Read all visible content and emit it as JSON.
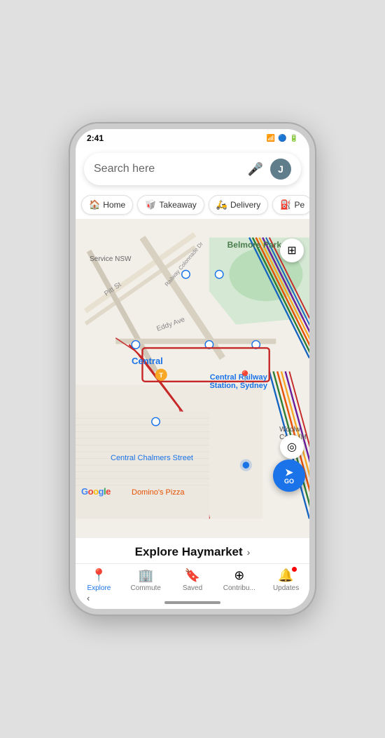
{
  "status": {
    "time": "2:41",
    "icons": [
      "●",
      "▲",
      "□"
    ]
  },
  "search": {
    "placeholder": "Search here",
    "mic_label": "🎤",
    "avatar_letter": "J"
  },
  "quick_actions": [
    {
      "icon": "🏠",
      "label": "Home"
    },
    {
      "icon": "🥡",
      "label": "Takeaway"
    },
    {
      "icon": "🛵",
      "label": "Delivery"
    },
    {
      "icon": "⛽",
      "label": "Pe"
    }
  ],
  "map": {
    "labels": {
      "belmore_park": "Belmore Park",
      "service_nsw": "Service NSW",
      "pitt_st": "Pitt St",
      "railway_col": "Railway Colonnade Dr",
      "eddy_ave": "Eddy Ave",
      "central": "Central",
      "central_railway": "Central Railway\nStation, Sydney",
      "woolw": "Woolw\nCentr (M",
      "central_chalmers": "Central Chalmers Street",
      "dominos": "Domino's Pizza",
      "google": "Google"
    },
    "buttons": {
      "layers": "⊞",
      "go": "GO",
      "location": "◎"
    }
  },
  "explore_bar": {
    "title": "Explore Haymarket",
    "arrow": "›"
  },
  "bottom_nav": [
    {
      "icon": "📍",
      "label": "Explore",
      "active": true
    },
    {
      "icon": "🏢",
      "label": "Commute",
      "active": false
    },
    {
      "icon": "🔖",
      "label": "Saved",
      "active": false
    },
    {
      "icon": "⊕",
      "label": "Contribu...",
      "active": false
    },
    {
      "icon": "🔔",
      "label": "Updates",
      "active": false,
      "badge": true
    }
  ],
  "home_indicator": {}
}
